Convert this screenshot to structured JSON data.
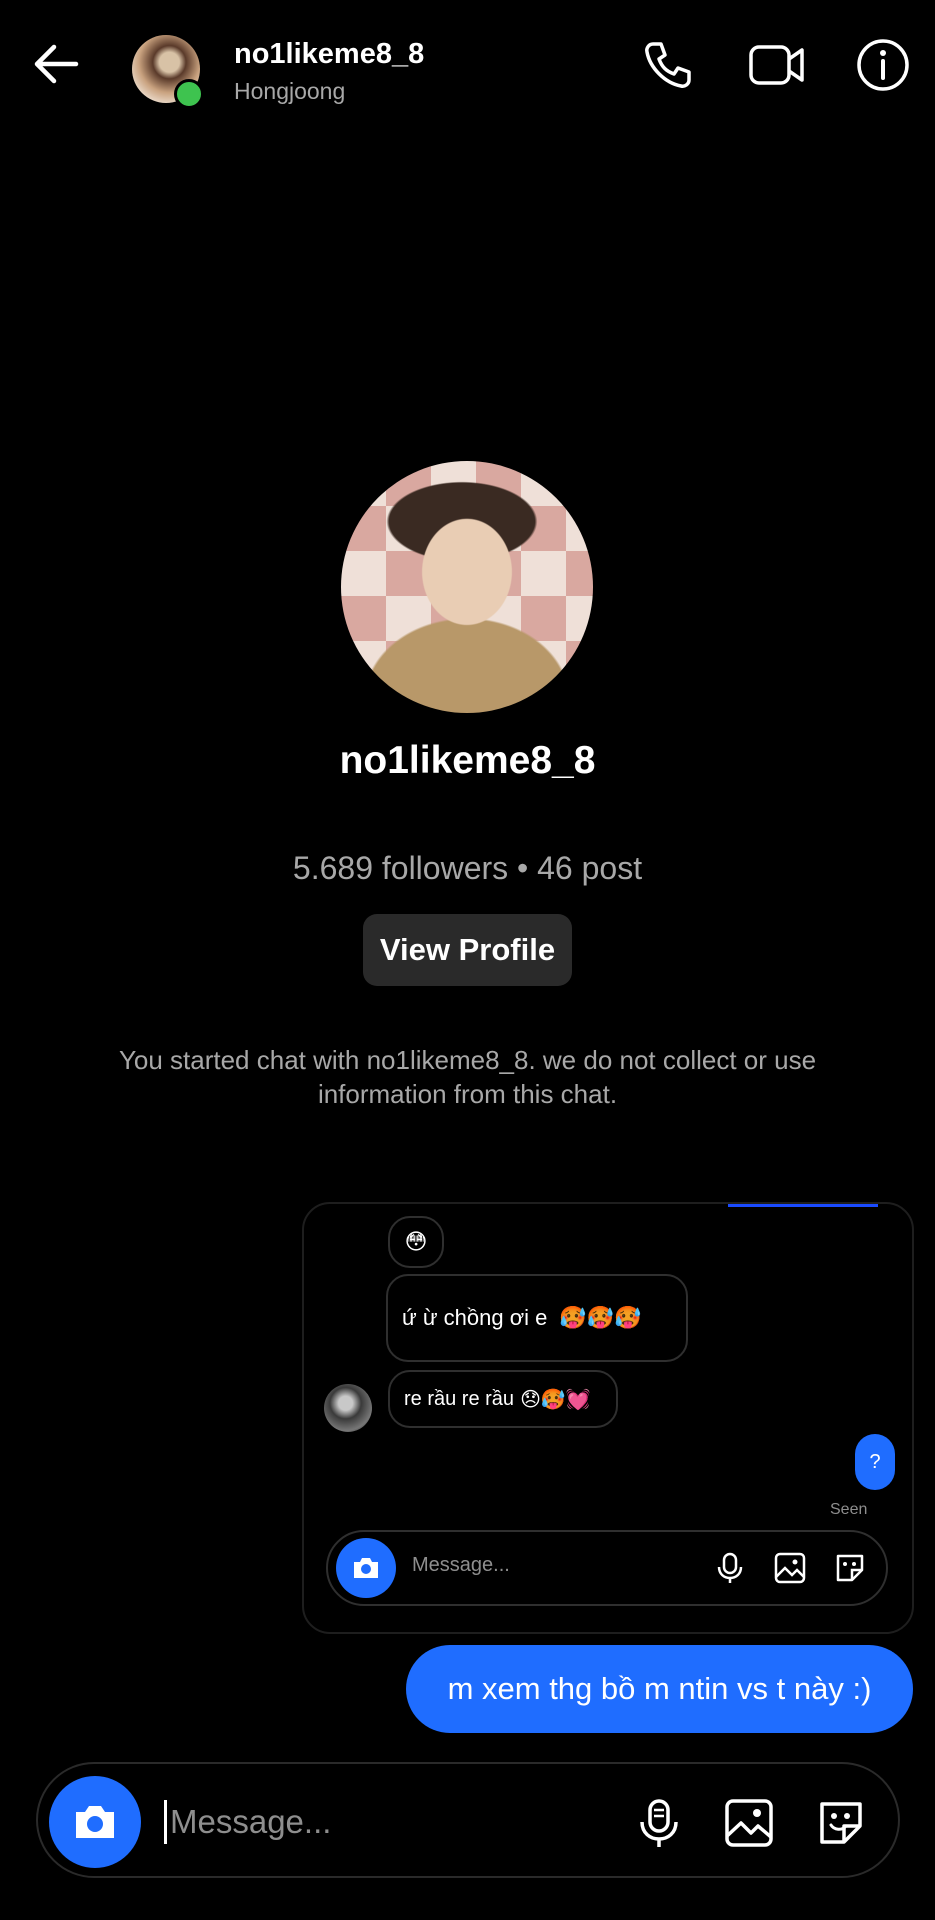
{
  "header": {
    "username": "no1likeme8_8",
    "subtitle": "Hongjoong",
    "icons": [
      "back-arrow-icon",
      "phone-icon",
      "video-camera-icon",
      "info-icon"
    ]
  },
  "profile": {
    "username": "no1likeme8_8",
    "stats": "5.689 followers • 46 post",
    "view_button": "View Profile",
    "notice": "You started chat with no1likeme8_8. we do not collect or use information from this chat."
  },
  "screenshot": {
    "emoji_reaction": "😳",
    "message1_text": "ứ ừ chồng ơi e",
    "message1_emoji": "🥵🥵🥵",
    "message2_text": "re rầu re rầu",
    "message2_emoji": "😞🥵💓",
    "sent_text": "?",
    "seen_label": "Seen",
    "input_placeholder": "Message..."
  },
  "outgoing_message": "m xem thg bồ m ntin vs t này :)",
  "composer": {
    "placeholder": "Message..."
  },
  "colors": {
    "background": "#000000",
    "accent": "#1f6dff",
    "online": "#3ec34f",
    "secondary_text": "#a8a8a8"
  }
}
